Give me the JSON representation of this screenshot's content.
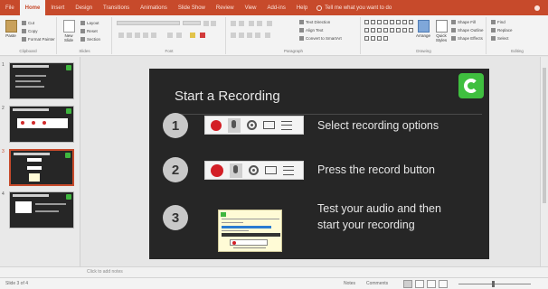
{
  "ribbon_tabs": [
    "File",
    "Home",
    "Insert",
    "Design",
    "Transitions",
    "Animations",
    "Slide Show",
    "Review",
    "View",
    "Add-ins",
    "Help"
  ],
  "tell_me": "Tell me what you want to do",
  "clipboard": {
    "paste": "Paste",
    "cut": "Cut",
    "copy": "Copy",
    "format_painter": "Format Painter",
    "label": "Clipboard"
  },
  "slides_group": {
    "new_slide": "New Slide",
    "layout": "Layout",
    "reset": "Reset",
    "section": "Section",
    "label": "Slides"
  },
  "font_group": {
    "label": "Font"
  },
  "paragraph_group": {
    "text_direction": "Text Direction",
    "align_text": "Align Text",
    "smartart": "Convert to SmartArt",
    "label": "Paragraph"
  },
  "drawing_group": {
    "arrange": "Arrange",
    "quick_styles": "Quick Styles",
    "shape_fill": "Shape Fill",
    "shape_outline": "Shape Outline",
    "shape_effects": "Shape Effects",
    "label": "Drawing"
  },
  "editing_group": {
    "find": "Find",
    "replace": "Replace",
    "select": "Select",
    "label": "Editing"
  },
  "thumbnails": [
    {
      "num": "1"
    },
    {
      "num": "2"
    },
    {
      "num": "3"
    },
    {
      "num": "4"
    }
  ],
  "slide": {
    "title": "Start a Recording",
    "steps": [
      {
        "num": "1",
        "text": "Select recording options"
      },
      {
        "num": "2",
        "text": "Press the record button"
      },
      {
        "num": "3",
        "text": "Test your audio and then",
        "text2": "start your recording"
      }
    ]
  },
  "notes_placeholder": "Click to add notes",
  "status": {
    "slide": "Slide 3 of 4",
    "notes": "Notes",
    "comments": "Comments"
  },
  "colors": {
    "accent": "#c74a2b",
    "slide_bg": "#262626",
    "logo": "#3fbf3f",
    "record": "#d31f26"
  }
}
